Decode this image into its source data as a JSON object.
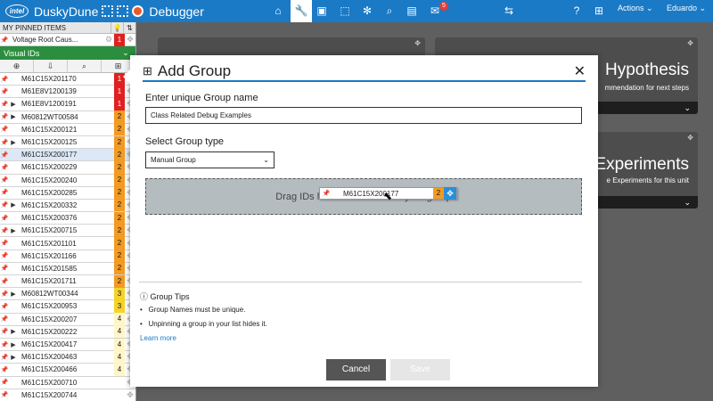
{
  "topbar": {
    "logo_text": "intel",
    "app_name": "DuskyDune",
    "app_sub": "Debugger",
    "notification_count": "5",
    "actions_label": "Actions ⌄",
    "user_label": "Eduardo ⌄",
    "icons": [
      "home-icon",
      "wrench-icon",
      "chip-icon",
      "cube-icon",
      "network-icon",
      "search-doc-icon",
      "document-icon",
      "chat-icon",
      "sync-icon",
      "help-icon",
      "grid-icon"
    ]
  },
  "left": {
    "pinned_header": "MY PINNED ITEMS",
    "pinned_item": {
      "label": "Voltage Root Caus...",
      "count": "1"
    },
    "visual_header": "Visual IDs",
    "ids": [
      {
        "name": "M61C15X201170",
        "count": "1",
        "level": "c1",
        "arrow": ""
      },
      {
        "name": "M61E8V1200139",
        "count": "1",
        "level": "c1",
        "arrow": ""
      },
      {
        "name": "M61E8V1200191",
        "count": "1",
        "level": "c1",
        "arrow": "▶"
      },
      {
        "name": "M60812WT00584",
        "count": "2",
        "level": "c2",
        "arrow": "▶"
      },
      {
        "name": "M61C15X200121",
        "count": "2",
        "level": "c2",
        "arrow": ""
      },
      {
        "name": "M61C15X200125",
        "count": "2",
        "level": "c2",
        "arrow": "▶"
      },
      {
        "name": "M61C15X200177",
        "count": "2",
        "level": "c2",
        "arrow": "",
        "selected": true
      },
      {
        "name": "M61C15X200229",
        "count": "2",
        "level": "c2",
        "arrow": ""
      },
      {
        "name": "M61C15X200240",
        "count": "2",
        "level": "c2",
        "arrow": ""
      },
      {
        "name": "M61C15X200285",
        "count": "2",
        "level": "c2",
        "arrow": ""
      },
      {
        "name": "M61C15X200332",
        "count": "2",
        "level": "c2",
        "arrow": "▶"
      },
      {
        "name": "M61C15X200376",
        "count": "2",
        "level": "c2",
        "arrow": ""
      },
      {
        "name": "M61C15X200715",
        "count": "2",
        "level": "c2",
        "arrow": "▶"
      },
      {
        "name": "M61C15X201101",
        "count": "2",
        "level": "c2",
        "arrow": ""
      },
      {
        "name": "M61C15X201166",
        "count": "2",
        "level": "c2",
        "arrow": ""
      },
      {
        "name": "M61C15X201585",
        "count": "2",
        "level": "c2",
        "arrow": ""
      },
      {
        "name": "M61C15X201711",
        "count": "2",
        "level": "c2",
        "arrow": ""
      },
      {
        "name": "M60812WT00344",
        "count": "3",
        "level": "c3",
        "arrow": "▶"
      },
      {
        "name": "M61C15X200953",
        "count": "3",
        "level": "c3",
        "arrow": ""
      },
      {
        "name": "M61C15X200207",
        "count": "4",
        "level": "c4",
        "arrow": ""
      },
      {
        "name": "M61C15X200222",
        "count": "4",
        "level": "c4",
        "arrow": "▶"
      },
      {
        "name": "M61C15X200417",
        "count": "4",
        "level": "c4",
        "arrow": "▶"
      },
      {
        "name": "M61C15X200463",
        "count": "4",
        "level": "c4",
        "arrow": "▶"
      },
      {
        "name": "M61C15X200466",
        "count": "4",
        "level": "c4",
        "arrow": ""
      },
      {
        "name": "M61C15X200710",
        "count": "",
        "level": "",
        "arrow": ""
      },
      {
        "name": "M61C15X200744",
        "count": "",
        "level": "",
        "arrow": ""
      }
    ]
  },
  "cards": {
    "hypothesis_title": "Hypothesis",
    "hypothesis_sub": "mmendation for next steps",
    "experiments_title": "Experiments",
    "experiments_sub": "e Experiments for this unit"
  },
  "modal": {
    "title": "Add Group",
    "name_label": "Enter unique Group name",
    "name_value": "Class Related Debug Examples",
    "type_label": "Select Group type",
    "type_value": "Manual Group",
    "drop_text": "Drag IDs here to add them to your group",
    "drag_item": {
      "name": "M61C15X200177",
      "count": "2"
    },
    "tips_header": "Group Tips",
    "tips": [
      "Group Names must be unique.",
      "Unpinning a group in your list hides it."
    ],
    "learn_more": "Learn more",
    "cancel": "Cancel",
    "save": "Save"
  }
}
